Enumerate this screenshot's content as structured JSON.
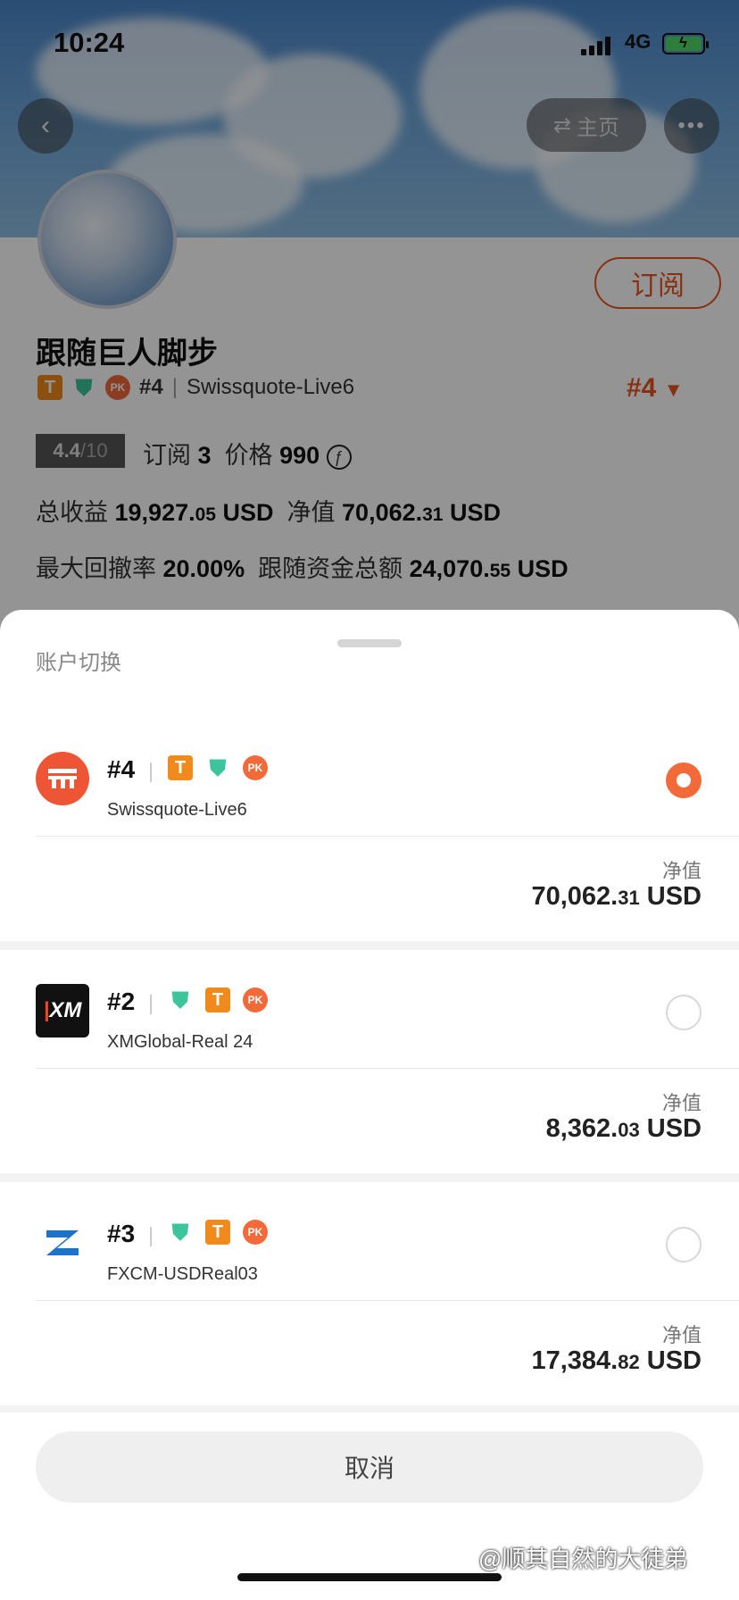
{
  "status_bar": {
    "time": "10:24",
    "network": "4G"
  },
  "header": {
    "back_icon": "chevron-left-icon",
    "home_label": "主页",
    "more_icon": "more-icon"
  },
  "profile": {
    "name": "跟随巨人脚步",
    "subscribe_label": "订阅",
    "rank": "#4",
    "server": "Swissquote-Live6",
    "rank_selector": "#4",
    "score": "4.4",
    "score_max": "/10",
    "subscribe_count_label": "订阅",
    "subscribe_count": "3",
    "price_label": "价格",
    "price": "990",
    "total_profit_label": "总收益",
    "total_profit": "19,927.",
    "total_profit_dec": "05",
    "currency": "USD",
    "net_value_label": "净值",
    "net_value": "70,062.",
    "net_value_dec": "31",
    "max_drawdown_label": "最大回撤率",
    "max_drawdown": "20.00%",
    "follow_funds_label": "跟随资金总额",
    "follow_funds": "24,070.",
    "follow_funds_dec": "55"
  },
  "sheet": {
    "title": "账户切换",
    "accounts": [
      {
        "rank": "#4",
        "server": "Swissquote-Live6",
        "nv_label": "净值",
        "nv_int": "70,062.",
        "nv_dec": "31",
        "currency": "USD",
        "selected": true
      },
      {
        "rank": "#2",
        "server": "XMGlobal-Real 24",
        "nv_label": "净值",
        "nv_int": "8,362.",
        "nv_dec": "03",
        "currency": "USD",
        "selected": false
      },
      {
        "rank": "#3",
        "server": "FXCM-USDReal03",
        "nv_label": "净值",
        "nv_int": "17,384.",
        "nv_dec": "82",
        "currency": "USD",
        "selected": false
      }
    ],
    "cancel_label": "取消"
  },
  "watermark": "@顺其自然的大徒弟",
  "colors": {
    "accent": "#e8541f",
    "shield": "#3cc59c",
    "badge_t": "#f08a1c"
  }
}
